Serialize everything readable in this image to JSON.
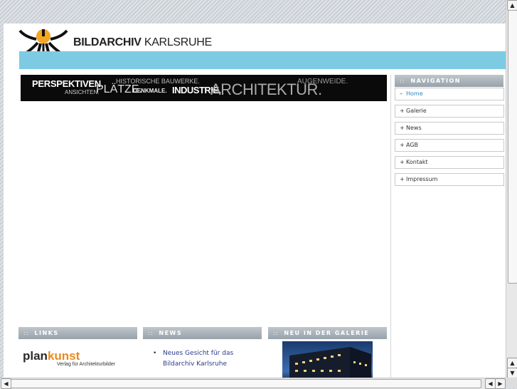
{
  "logo": {
    "name_bold": "BILDARCHIV",
    "name_regular": " KARLSRUHE"
  },
  "banner": {
    "perspektiven": "PERSPEKTIVEN.",
    "ansichten": "ANSICHTEN.",
    "plaetze": "PLÄTZE.",
    "historische": "HISTORISCHE BAUWERKE.",
    "denkmale": "DENKMALE.",
    "industrie": "INDUSTRIE.",
    "architektur": "ARCHITEKTUR.",
    "augenweide": "AUGENWEIDE."
  },
  "navigation": {
    "header": "NAVIGATION",
    "header_dots": "::",
    "items": [
      {
        "label": "Home",
        "sign": "–"
      },
      {
        "label": "Galerie",
        "sign": "+"
      },
      {
        "label": "News",
        "sign": "+"
      },
      {
        "label": "AGB",
        "sign": "+"
      },
      {
        "label": "Kontakt",
        "sign": "+"
      },
      {
        "label": "Impressum",
        "sign": "+"
      }
    ]
  },
  "links": {
    "header": "LINKS",
    "header_dots": "::",
    "plankunst_a": "plan",
    "plankunst_b": "kunst",
    "plankunst_sub": "Verlag für Architekturbilder"
  },
  "news": {
    "header": "NEWS",
    "header_dots": "::",
    "items": [
      "Neues Gesicht für das Bildarchiv Karlsruhe"
    ]
  },
  "gallery": {
    "header": "NEU IN DER GALERIE",
    "header_dots": "::"
  },
  "colors": {
    "accent_cyan": "#7dcbe3",
    "logo_orange": "#f5a623",
    "link_blue": "#2b86c5",
    "plankunst_orange": "#e88a1a"
  },
  "icons": {
    "logo": "sun-figure-icon"
  }
}
